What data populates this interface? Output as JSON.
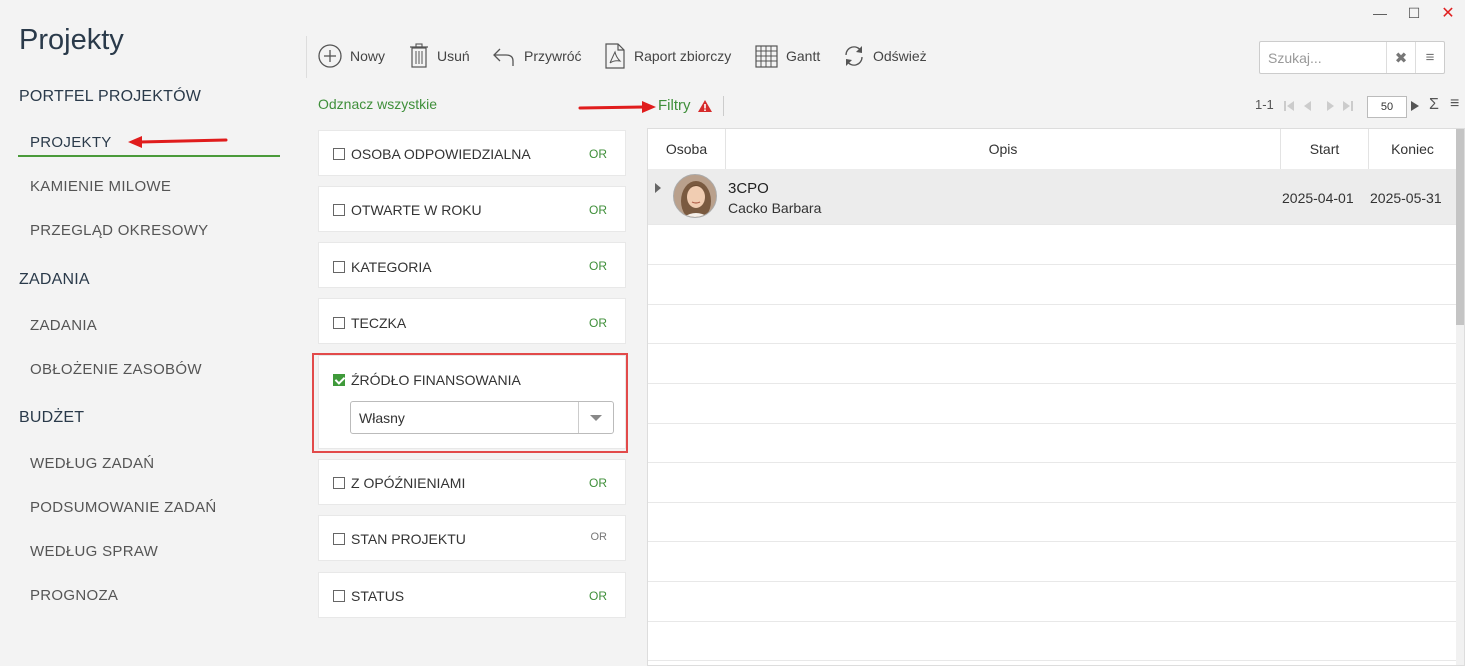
{
  "app": {
    "title": "Projekty"
  },
  "sidebar": {
    "sections": [
      {
        "label": "PORTFEL PROJEKTÓW",
        "items": [
          {
            "label": "PROJEKTY",
            "active": true
          },
          {
            "label": "KAMIENIE MILOWE"
          },
          {
            "label": "PRZEGLĄD OKRESOWY"
          }
        ]
      },
      {
        "label": "ZADANIA",
        "items": [
          {
            "label": "ZADANIA"
          },
          {
            "label": "OBŁOŻENIE ZASOBÓW"
          }
        ]
      },
      {
        "label": "BUDŻET",
        "items": [
          {
            "label": "WEDŁUG ZADAŃ"
          },
          {
            "label": "PODSUMOWANIE ZADAŃ"
          },
          {
            "label": "WEDŁUG SPRAW"
          },
          {
            "label": "PROGNOZA"
          }
        ]
      }
    ]
  },
  "toolbar": {
    "new": "Nowy",
    "delete": "Usuń",
    "restore": "Przywróć",
    "report": "Raport zbiorczy",
    "gantt": "Gantt",
    "refresh": "Odśwież"
  },
  "search": {
    "placeholder": "Szukaj..."
  },
  "filters": {
    "select_all": "Odznacz wszystkie",
    "title": "Filtry",
    "or_label": "OR",
    "items": [
      {
        "label": "OSOBA ODPOWIEDZIALNA",
        "checked": false
      },
      {
        "label": "OTWARTE W ROKU",
        "checked": false
      },
      {
        "label": "KATEGORIA",
        "checked": false
      },
      {
        "label": "TECZKA",
        "checked": false
      },
      {
        "label": "ŹRÓDŁO FINANSOWANIA",
        "checked": true,
        "value": "Własny"
      },
      {
        "label": "Z OPÓŹNIENIAMI",
        "checked": false
      },
      {
        "label": "STAN PROJEKTU",
        "checked": false
      },
      {
        "label": "STATUS",
        "checked": false
      }
    ]
  },
  "pager": {
    "range": "1-1",
    "page_size": "50"
  },
  "grid": {
    "columns": [
      "Osoba",
      "Opis",
      "Start",
      "Koniec"
    ],
    "rows": [
      {
        "name": "3CPO",
        "person": "Cacko Barbara",
        "start": "2025-04-01",
        "end": "2025-05-31"
      }
    ]
  },
  "colors": {
    "accent_green": "#3f8f3a",
    "highlight_red": "#e24a4a",
    "arrow_red": "#e01c1c"
  }
}
